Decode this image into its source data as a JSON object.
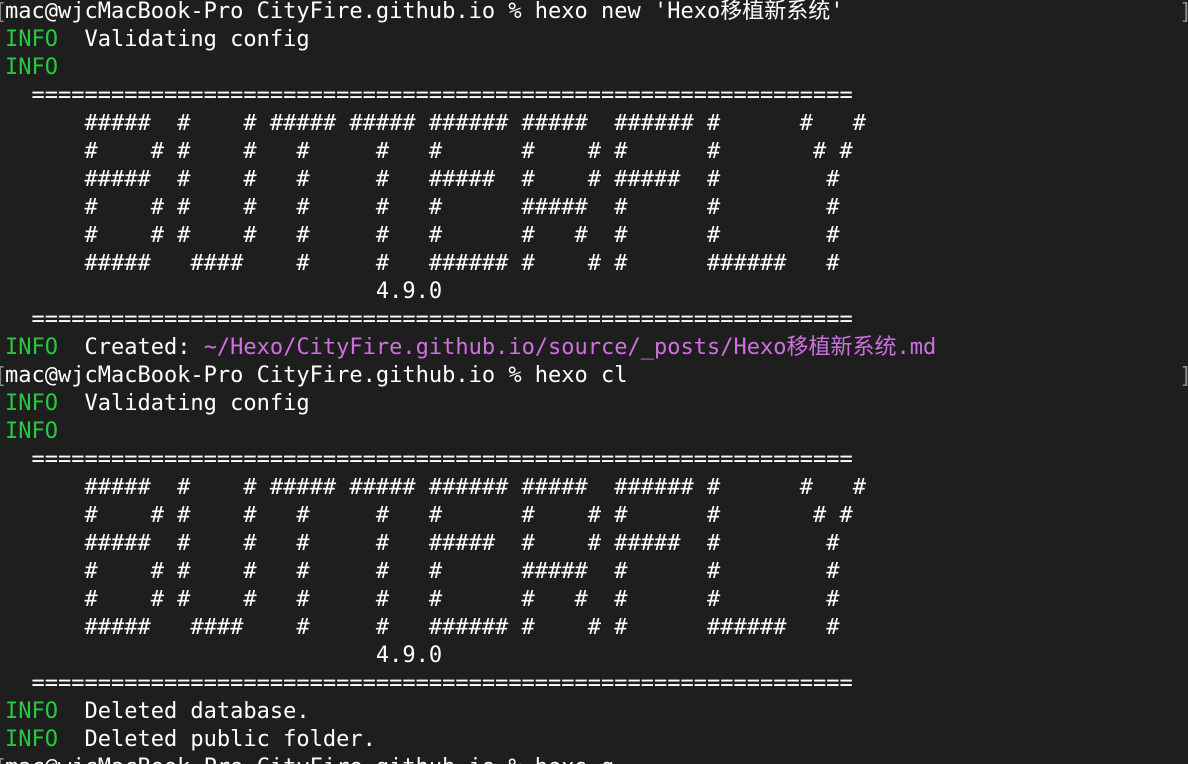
{
  "terminal": {
    "lines": [
      {
        "kind": "prompt",
        "text": "mac@wjcMacBook-Pro CityFire.github.io % hexo new 'Hexo移植新系统'"
      },
      {
        "kind": "info",
        "tag": "INFO",
        "text": "  Validating config"
      },
      {
        "kind": "info",
        "tag": "INFO",
        "text": ""
      },
      {
        "kind": "text",
        "text": "  =============================================================="
      },
      {
        "kind": "text",
        "text": "      #####  #    # ##### ##### ###### #####  ###### #      #   #"
      },
      {
        "kind": "text",
        "text": "      #    # #    #   #     #   #      #    # #      #       # #"
      },
      {
        "kind": "text",
        "text": "      #####  #    #   #     #   #####  #    # #####  #        #"
      },
      {
        "kind": "text",
        "text": "      #    # #    #   #     #   #      #####  #      #        #"
      },
      {
        "kind": "text",
        "text": "      #    # #    #   #     #   #      #   #  #      #        #"
      },
      {
        "kind": "text",
        "text": "      #####   ####    #     #   ###### #    # #      ######   #"
      },
      {
        "kind": "text",
        "text": "                            4.9.0"
      },
      {
        "kind": "text",
        "text": "  =============================================================="
      },
      {
        "kind": "info-path",
        "tag": "INFO",
        "text": "  Created: ",
        "path": "~/Hexo/CityFire.github.io/source/_posts/Hexo移植新系统.md"
      },
      {
        "kind": "prompt",
        "text": "mac@wjcMacBook-Pro CityFire.github.io % hexo cl"
      },
      {
        "kind": "info",
        "tag": "INFO",
        "text": "  Validating config"
      },
      {
        "kind": "info",
        "tag": "INFO",
        "text": ""
      },
      {
        "kind": "text",
        "text": "  =============================================================="
      },
      {
        "kind": "text",
        "text": "      #####  #    # ##### ##### ###### #####  ###### #      #   #"
      },
      {
        "kind": "text",
        "text": "      #    # #    #   #     #   #      #    # #      #       # #"
      },
      {
        "kind": "text",
        "text": "      #####  #    #   #     #   #####  #    # #####  #        #"
      },
      {
        "kind": "text",
        "text": "      #    # #    #   #     #   #      #####  #      #        #"
      },
      {
        "kind": "text",
        "text": "      #    # #    #   #     #   #      #   #  #      #        #"
      },
      {
        "kind": "text",
        "text": "      #####   ####    #     #   ###### #    # #      ######   #"
      },
      {
        "kind": "text",
        "text": "                            4.9.0"
      },
      {
        "kind": "text",
        "text": "  =============================================================="
      },
      {
        "kind": "info",
        "tag": "INFO",
        "text": "  Deleted database."
      },
      {
        "kind": "info",
        "tag": "INFO",
        "text": "  Deleted public folder."
      },
      {
        "kind": "prompt",
        "text": "mac@wjcMacBook-Pro CityFire.github.io % hexo g"
      }
    ],
    "marks": {
      "left_bracket": "[",
      "right_bracket": "]"
    }
  },
  "colors": {
    "background": "#1e1e1e",
    "text": "#ffffff",
    "info": "#27c93f",
    "path": "#d070e0"
  }
}
